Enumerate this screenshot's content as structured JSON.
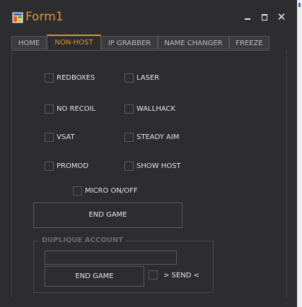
{
  "window": {
    "title": "Form1"
  },
  "controls": {
    "minimize": "minimize",
    "maximize": "maximize",
    "close": "✕"
  },
  "tabs": [
    {
      "label": "HOME",
      "active": false
    },
    {
      "label": "NON-HOST",
      "active": true
    },
    {
      "label": "IP GRABBER",
      "active": false
    },
    {
      "label": "NAME CHANGER",
      "active": false
    },
    {
      "label": "FREEZE",
      "active": false
    }
  ],
  "checkboxes": {
    "redboxes": {
      "label": "REDBOXES",
      "checked": false
    },
    "laser": {
      "label": "LASER",
      "checked": false
    },
    "no_recoil": {
      "label": "NO RECOIL",
      "checked": false
    },
    "wallhack": {
      "label": "WALLHACK",
      "checked": false
    },
    "vsat": {
      "label": "VSAT",
      "checked": false
    },
    "steady_aim": {
      "label": "STEADY AIM",
      "checked": false
    },
    "promod": {
      "label": "PROMOD",
      "checked": false
    },
    "show_host": {
      "label": "SHOW HOST",
      "checked": false
    },
    "micro": {
      "label": "MICRO ON/OFF",
      "checked": false
    },
    "send": {
      "label": "> SEND <",
      "checked": false
    }
  },
  "buttons": {
    "end_game": "END GAME",
    "group_end_game": "END GAME"
  },
  "group": {
    "title": "DUPLIQUE ACCOUNT",
    "input_value": ""
  },
  "colors": {
    "accent": "#e8902c",
    "background": "#2d2d30",
    "border": "#5b5b5f"
  }
}
